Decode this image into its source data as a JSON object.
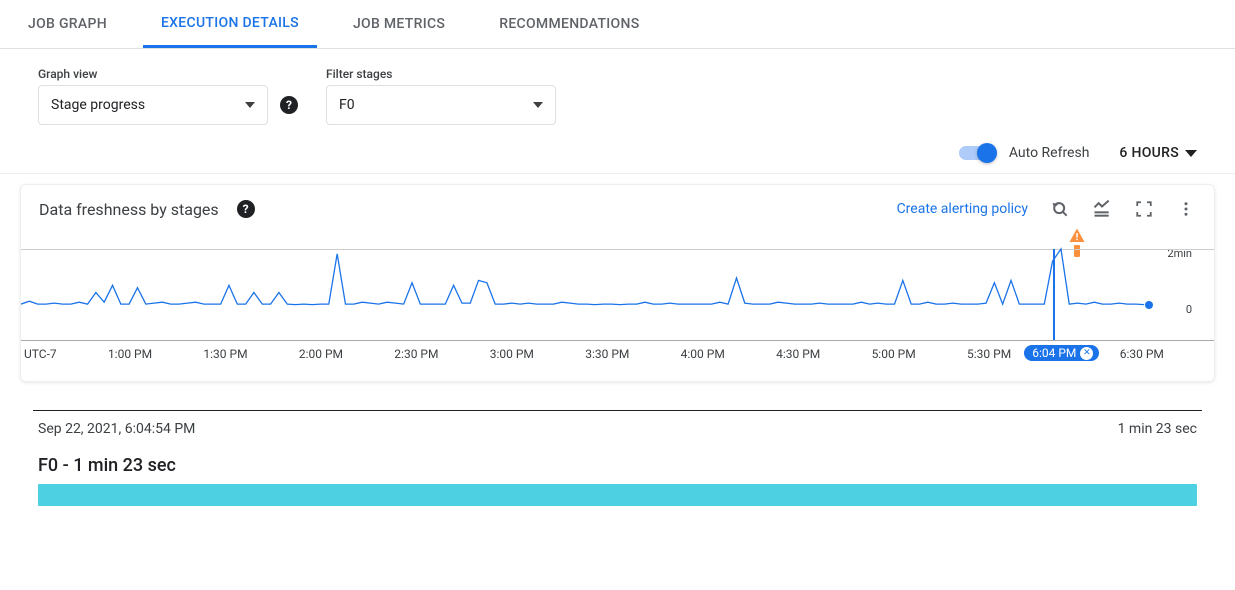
{
  "tabs": {
    "job_graph": "JOB GRAPH",
    "execution_details": "EXECUTION DETAILS",
    "job_metrics": "JOB METRICS",
    "recommendations": "RECOMMENDATIONS"
  },
  "filters": {
    "graph_view_label": "Graph view",
    "graph_view_value": "Stage progress",
    "filter_stages_label": "Filter stages",
    "filter_stages_value": "F0"
  },
  "controls": {
    "auto_refresh": "Auto Refresh",
    "range": "6 HOURS"
  },
  "chart": {
    "title": "Data freshness by stages",
    "alert_link": "Create alerting policy",
    "timezone": "UTC-7",
    "badge_time": "6:04 PM"
  },
  "chart_data": {
    "type": "line",
    "xlabel": "",
    "ylabel": "",
    "ylim_label_top": "2min",
    "ylim_label_bottom": "0",
    "ylim": [
      0,
      120
    ],
    "selected_x": "6:04 PM",
    "categories": [
      "UTC-7",
      "1:00 PM",
      "1:30 PM",
      "2:00 PM",
      "2:30 PM",
      "3:00 PM",
      "3:30 PM",
      "4:00 PM",
      "4:30 PM",
      "5:00 PM",
      "5:30 PM",
      "6:04 PM",
      "6:30 PM"
    ],
    "series": [
      {
        "name": "F0",
        "color": "#1a73e8",
        "values_sec": [
          6,
          12,
          6,
          6,
          8,
          6,
          6,
          10,
          6,
          30,
          10,
          45,
          6,
          6,
          40,
          6,
          8,
          10,
          6,
          6,
          8,
          10,
          6,
          6,
          6,
          45,
          6,
          6,
          30,
          6,
          6,
          30,
          6,
          5,
          6,
          5,
          6,
          6,
          110,
          6,
          6,
          10,
          8,
          6,
          10,
          8,
          6,
          50,
          6,
          6,
          6,
          6,
          45,
          8,
          8,
          55,
          50,
          6,
          6,
          8,
          6,
          8,
          6,
          6,
          6,
          10,
          8,
          6,
          6,
          5,
          6,
          6,
          5,
          6,
          6,
          10,
          6,
          6,
          8,
          6,
          6,
          6,
          6,
          6,
          10,
          6,
          60,
          8,
          6,
          6,
          6,
          10,
          8,
          6,
          6,
          6,
          8,
          6,
          6,
          6,
          6,
          10,
          6,
          8,
          6,
          6,
          55,
          6,
          6,
          10,
          6,
          6,
          8,
          6,
          6,
          6,
          8,
          50,
          6,
          55,
          6,
          6,
          6,
          6,
          95,
          120,
          6,
          8,
          6,
          10,
          6,
          6,
          8,
          6,
          6,
          5
        ]
      }
    ]
  },
  "detail": {
    "timestamp": "Sep 22, 2021, 6:04:54 PM",
    "duration": "1 min 23 sec",
    "stage_line": "F0 - 1 min 23 sec"
  }
}
